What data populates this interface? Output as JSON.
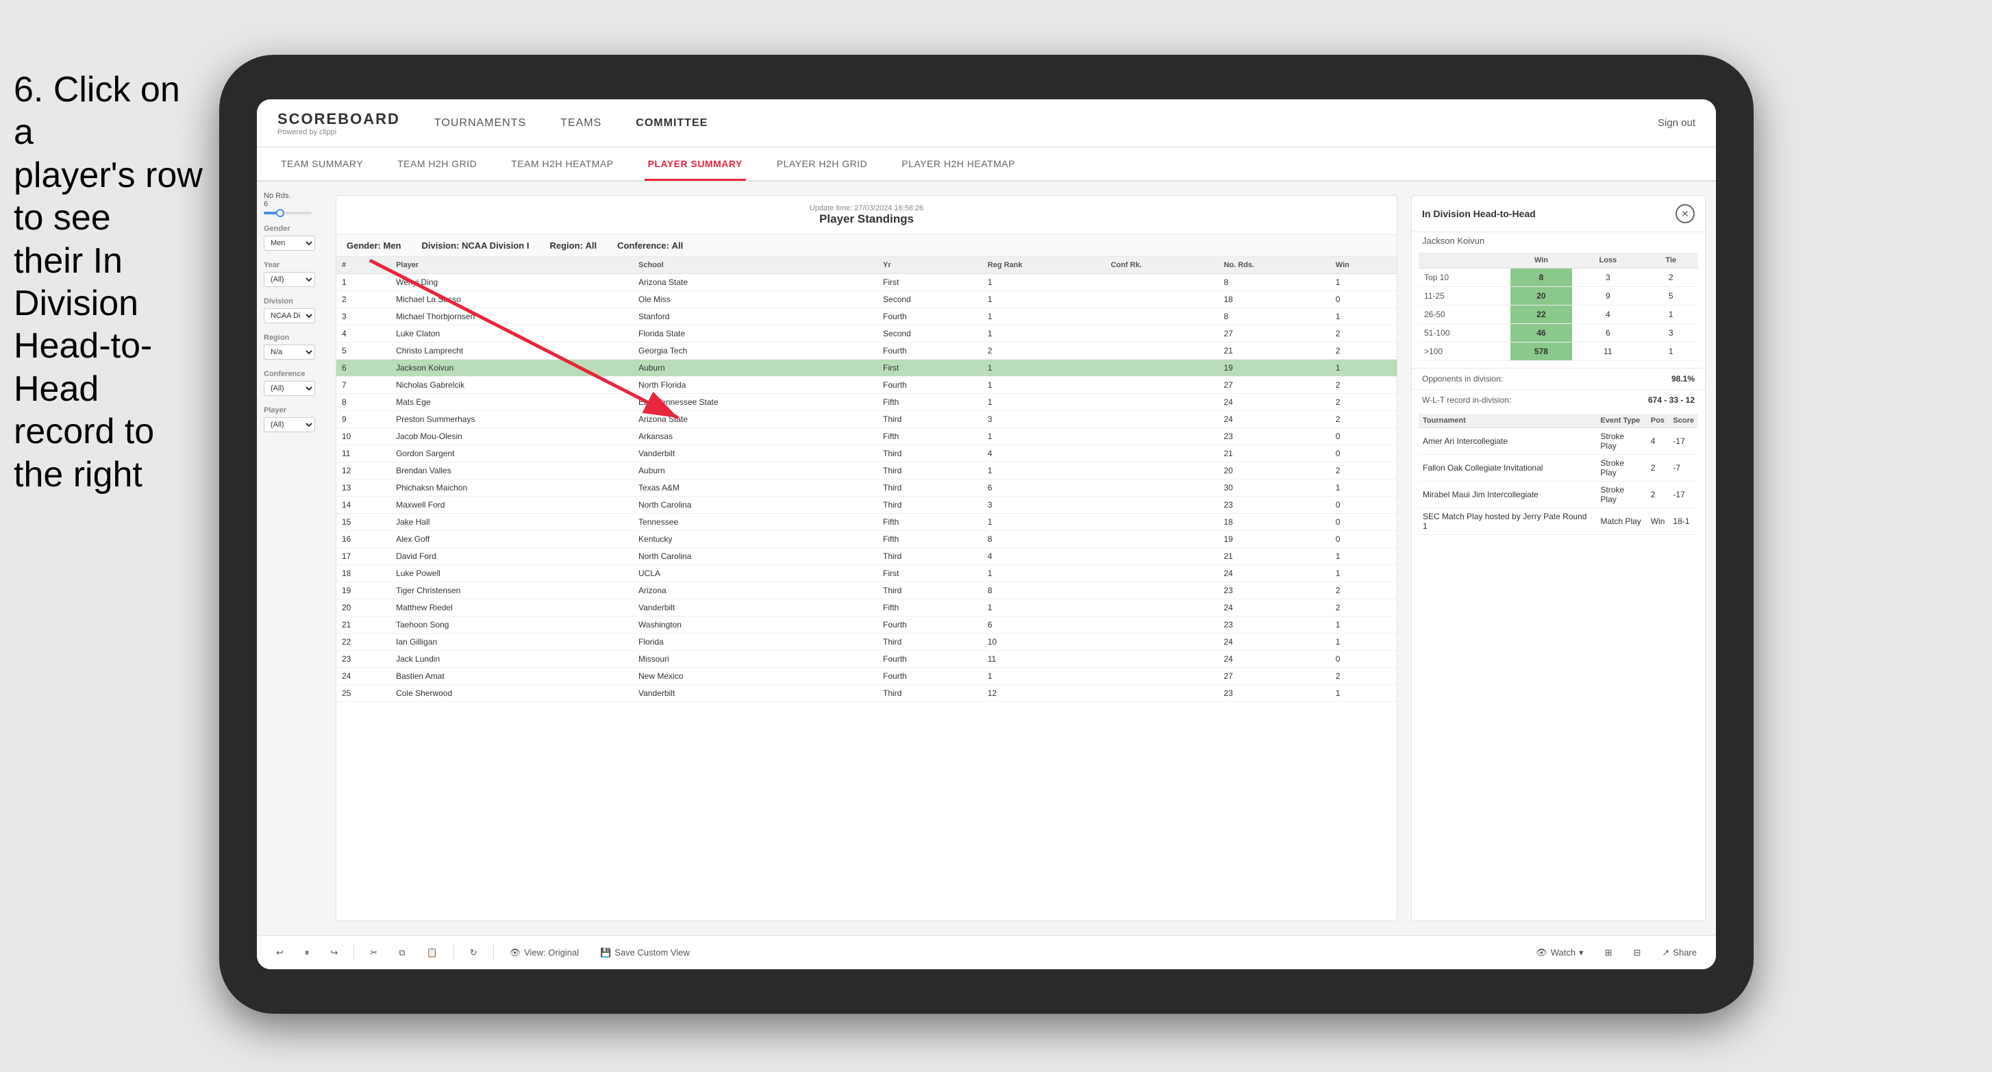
{
  "instruction": {
    "line1": "6. Click on a",
    "line2": "player's row to see",
    "line3": "their In Division",
    "line4": "Head-to-Head",
    "line5": "record to the right"
  },
  "nav": {
    "logo_title": "SCOREBOARD",
    "logo_subtitle": "Powered by clippi",
    "links": [
      "TOURNAMENTS",
      "TEAMS",
      "COMMITTEE"
    ],
    "sign_out": "Sign out"
  },
  "sub_tabs": [
    "TEAM SUMMARY",
    "TEAM H2H GRID",
    "TEAM H2H HEATMAP",
    "PLAYER SUMMARY",
    "PLAYER H2H GRID",
    "PLAYER H2H HEATMAP"
  ],
  "active_sub_tab": "PLAYER SUMMARY",
  "panel": {
    "title": "Player Standings",
    "update_label": "Update time:",
    "update_time": "27/03/2024 16:56:26",
    "filters": {
      "gender_label": "Gender:",
      "gender_value": "Men",
      "division_label": "Division:",
      "division_value": "NCAA Division I",
      "region_label": "Region:",
      "region_value": "All",
      "conference_label": "Conference:",
      "conference_value": "All"
    }
  },
  "table_headers": [
    "#",
    "Player",
    "School",
    "Yr",
    "Reg Rank",
    "Conf Rank",
    "No. Rds.",
    "Win"
  ],
  "players": [
    {
      "rank": 1,
      "name": "Wenyi Ding",
      "school": "Arizona State",
      "year": "First",
      "reg_rank": 1,
      "conf_rank": "",
      "no_rds": 8,
      "win": 1
    },
    {
      "rank": 2,
      "name": "Michael La Sasso",
      "school": "Ole Miss",
      "year": "Second",
      "reg_rank": 1,
      "conf_rank": "",
      "no_rds": 18,
      "win": 0
    },
    {
      "rank": 3,
      "name": "Michael Thorbjornsen",
      "school": "Stanford",
      "year": "Fourth",
      "reg_rank": 1,
      "conf_rank": "",
      "no_rds": 8,
      "win": 1
    },
    {
      "rank": 4,
      "name": "Luke Claton",
      "school": "Florida State",
      "year": "Second",
      "reg_rank": 1,
      "conf_rank": "",
      "no_rds": 27,
      "win": 2
    },
    {
      "rank": 5,
      "name": "Christo Lamprecht",
      "school": "Georgia Tech",
      "year": "Fourth",
      "reg_rank": 2,
      "conf_rank": "",
      "no_rds": 21,
      "win": 2
    },
    {
      "rank": 6,
      "name": "Jackson Koivun",
      "school": "Auburn",
      "year": "First",
      "reg_rank": 1,
      "conf_rank": "",
      "no_rds": 19,
      "win": 1
    },
    {
      "rank": 7,
      "name": "Nicholas Gabrelcik",
      "school": "North Florida",
      "year": "Fourth",
      "reg_rank": 1,
      "conf_rank": "",
      "no_rds": 27,
      "win": 2
    },
    {
      "rank": 8,
      "name": "Mats Ege",
      "school": "East Tennessee State",
      "year": "Fifth",
      "reg_rank": 1,
      "conf_rank": "",
      "no_rds": 24,
      "win": 2
    },
    {
      "rank": 9,
      "name": "Preston Summerhays",
      "school": "Arizona State",
      "year": "Third",
      "reg_rank": 3,
      "conf_rank": "",
      "no_rds": 24,
      "win": 2
    },
    {
      "rank": 10,
      "name": "Jacob Mou-Olesin",
      "school": "Arkansas",
      "year": "Fifth",
      "reg_rank": 1,
      "conf_rank": "",
      "no_rds": 23,
      "win": 0
    },
    {
      "rank": 11,
      "name": "Gordon Sargent",
      "school": "Vanderbilt",
      "year": "Third",
      "reg_rank": 4,
      "conf_rank": "",
      "no_rds": 21,
      "win": 0
    },
    {
      "rank": 12,
      "name": "Brendan Valles",
      "school": "Auburn",
      "year": "Third",
      "reg_rank": 1,
      "conf_rank": "",
      "no_rds": 20,
      "win": 2
    },
    {
      "rank": 13,
      "name": "Phichaksn Maichon",
      "school": "Texas A&M",
      "year": "Third",
      "reg_rank": 6,
      "conf_rank": "",
      "no_rds": 30,
      "win": 1
    },
    {
      "rank": 14,
      "name": "Maxwell Ford",
      "school": "North Carolina",
      "year": "Third",
      "reg_rank": 3,
      "conf_rank": "",
      "no_rds": 23,
      "win": 0
    },
    {
      "rank": 15,
      "name": "Jake Hall",
      "school": "Tennessee",
      "year": "Fifth",
      "reg_rank": 1,
      "conf_rank": "",
      "no_rds": 18,
      "win": 0
    },
    {
      "rank": 16,
      "name": "Alex Goff",
      "school": "Kentucky",
      "year": "Fifth",
      "reg_rank": 8,
      "conf_rank": "",
      "no_rds": 19,
      "win": 0
    },
    {
      "rank": 17,
      "name": "David Ford",
      "school": "North Carolina",
      "year": "Third",
      "reg_rank": 4,
      "conf_rank": "",
      "no_rds": 21,
      "win": 1
    },
    {
      "rank": 18,
      "name": "Luke Powell",
      "school": "UCLA",
      "year": "First",
      "reg_rank": 1,
      "conf_rank": "",
      "no_rds": 24,
      "win": 1
    },
    {
      "rank": 19,
      "name": "Tiger Christensen",
      "school": "Arizona",
      "year": "Third",
      "reg_rank": 8,
      "conf_rank": "",
      "no_rds": 23,
      "win": 2
    },
    {
      "rank": 20,
      "name": "Matthew Riedel",
      "school": "Vanderbilt",
      "year": "Fifth",
      "reg_rank": 1,
      "conf_rank": "",
      "no_rds": 24,
      "win": 2
    },
    {
      "rank": 21,
      "name": "Taehoon Song",
      "school": "Washington",
      "year": "Fourth",
      "reg_rank": 6,
      "conf_rank": "",
      "no_rds": 23,
      "win": 1
    },
    {
      "rank": 22,
      "name": "Ian Gilligan",
      "school": "Florida",
      "year": "Third",
      "reg_rank": 10,
      "conf_rank": "",
      "no_rds": 24,
      "win": 1
    },
    {
      "rank": 23,
      "name": "Jack Lundin",
      "school": "Missouri",
      "year": "Fourth",
      "reg_rank": 11,
      "conf_rank": "",
      "no_rds": 24,
      "win": 0
    },
    {
      "rank": 24,
      "name": "Bastien Amat",
      "school": "New Mexico",
      "year": "Fourth",
      "reg_rank": 1,
      "conf_rank": "",
      "no_rds": 27,
      "win": 2
    },
    {
      "rank": 25,
      "name": "Cole Sherwood",
      "school": "Vanderbilt",
      "year": "Third",
      "reg_rank": 12,
      "conf_rank": "",
      "no_rds": 23,
      "win": 1
    }
  ],
  "selected_player": "Jackson Koivun",
  "h2h": {
    "title": "In Division Head-to-Head",
    "player_name": "Jackson Koivun",
    "table_headers": [
      "",
      "Win",
      "Loss",
      "Tie"
    ],
    "rows": [
      {
        "label": "Top 10",
        "win": 8,
        "loss": 3,
        "tie": 2
      },
      {
        "label": "11-25",
        "win": 20,
        "loss": 9,
        "tie": 5
      },
      {
        "label": "26-50",
        "win": 22,
        "loss": 4,
        "tie": 1
      },
      {
        "label": "51-100",
        "win": 46,
        "loss": 6,
        "tie": 3
      },
      {
        "label": ">100",
        "win": 578,
        "loss": 11,
        "tie": 1
      }
    ],
    "opponents_label": "Opponents in division:",
    "opponents_value": "98.1%",
    "wlt_label": "W-L-T record in-division:",
    "wlt_value": "674 - 33 - 12",
    "tournament_headers": [
      "Tournament",
      "Event Type",
      "Pos",
      "Score"
    ],
    "tournaments": [
      {
        "name": "Amer Ari Intercollegiate",
        "type": "Stroke Play",
        "pos": 4,
        "score": "-17"
      },
      {
        "name": "Fallon Oak Collegiate Invitational",
        "type": "Stroke Play",
        "pos": 2,
        "score": "-7"
      },
      {
        "name": "Mirabel Maui Jim Intercollegiate",
        "type": "Stroke Play",
        "pos": 2,
        "score": "-17"
      },
      {
        "name": "SEC Match Play hosted by Jerry Pate Round 1",
        "type": "Match Play",
        "pos": "Win",
        "score": "18-1"
      }
    ]
  },
  "sidebar": {
    "no_rds_label": "No Rds.",
    "no_rds_value": "6",
    "gender_label": "Gender",
    "gender_value": "Men",
    "year_label": "Year",
    "year_value": "(All)",
    "division_label": "Division",
    "division_value": "NCAA Division I",
    "region_label": "Region",
    "region_value": "N/a",
    "conference_label": "Conference",
    "conference_value": "(All)",
    "player_label": "Player",
    "player_value": "(All)"
  },
  "toolbar": {
    "view_original": "View: Original",
    "save_custom": "Save Custom View",
    "watch": "Watch",
    "share": "Share"
  }
}
